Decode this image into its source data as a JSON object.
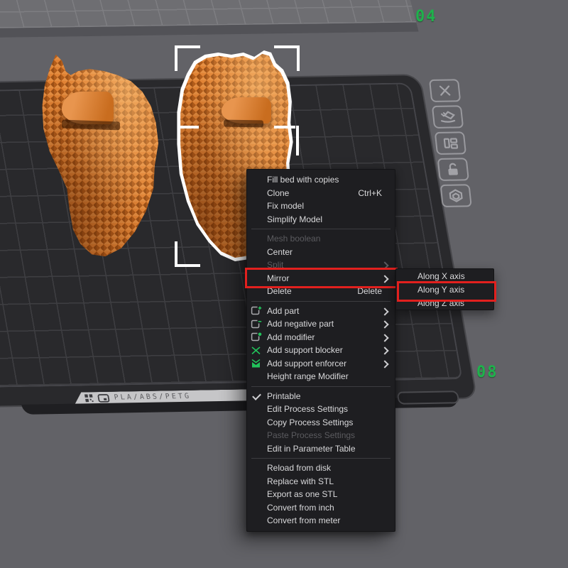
{
  "colors": {
    "background": "#626267",
    "plate": "#29292c",
    "plate_grid": "#3e3e42",
    "plate_rim": "#47474b",
    "back_plate": "#6e6e72",
    "back_plate_grid": "#7e7e82",
    "back_plate_side": "#525257",
    "accent_green": "#1fb14c",
    "highlight_red": "#e2201e",
    "model_orange": "#d8782a",
    "menu_bg": "#1e1e21",
    "menu_text": "#d9d9db",
    "menu_disabled": "#5b5b5f",
    "strip": "#c6c6c8",
    "selection_white": "#ffffff"
  },
  "plate": {
    "number_top": "04",
    "number_right": "08",
    "material_label": "PLA/ABS/PETG"
  },
  "toolbar": {
    "buttons": [
      {
        "icon": "delete-all"
      },
      {
        "icon": "auto-orient"
      },
      {
        "icon": "arrange"
      },
      {
        "icon": "lock-plate"
      },
      {
        "icon": "plate-settings"
      }
    ]
  },
  "context_menu": {
    "items": [
      {
        "label": "Fill bed with copies"
      },
      {
        "label": "Clone",
        "shortcut": "Ctrl+K"
      },
      {
        "label": "Fix model"
      },
      {
        "label": "Simplify Model"
      },
      {
        "label": "Mesh boolean",
        "disabled": true
      },
      {
        "label": "Center"
      },
      {
        "label": "Split",
        "disabled": true,
        "submenu": true
      },
      {
        "label": "Mirror",
        "submenu": true,
        "highlighted": true
      },
      {
        "label": "Delete",
        "shortcut": "Delete"
      },
      {
        "label": "Add part",
        "icon": "add-part",
        "submenu": true
      },
      {
        "label": "Add negative part",
        "icon": "add-negative-part",
        "submenu": true
      },
      {
        "label": "Add modifier",
        "icon": "add-modifier",
        "submenu": true
      },
      {
        "label": "Add support blocker",
        "icon": "support-blocker",
        "submenu": true
      },
      {
        "label": "Add support enforcer",
        "icon": "support-enforcer",
        "submenu": true
      },
      {
        "label": "Height range Modifier"
      },
      {
        "label": "Printable",
        "checked": true
      },
      {
        "label": "Edit Process Settings"
      },
      {
        "label": "Copy Process Settings"
      },
      {
        "label": "Paste Process Settings",
        "disabled": true
      },
      {
        "label": "Edit in Parameter Table"
      },
      {
        "label": "Reload from disk"
      },
      {
        "label": "Replace with STL"
      },
      {
        "label": "Export as one STL"
      },
      {
        "label": "Convert from inch"
      },
      {
        "label": "Convert from meter"
      }
    ],
    "submenu": {
      "items": [
        {
          "label": "Along X axis"
        },
        {
          "label": "Along Y axis",
          "highlighted": true
        },
        {
          "label": "Along Z axis"
        }
      ]
    }
  }
}
